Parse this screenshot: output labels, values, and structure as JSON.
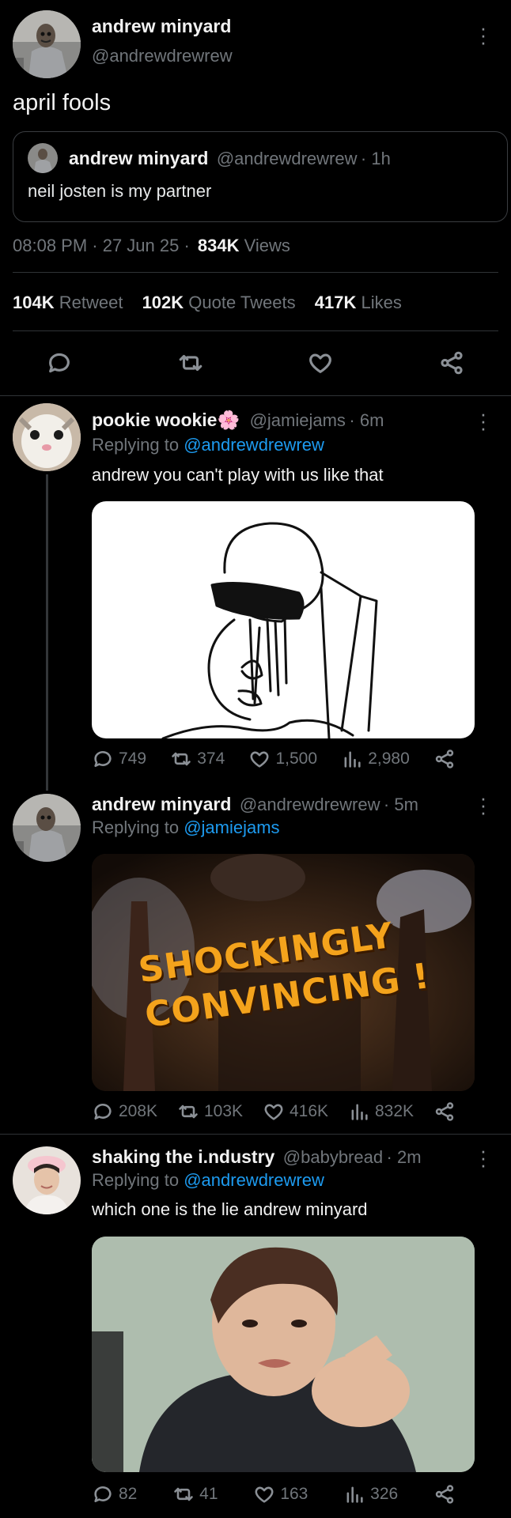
{
  "main_tweet": {
    "author_name": "andrew minyard",
    "author_handle": "@andrewdrewrew",
    "text": "april fools",
    "quoted": {
      "author_name": "andrew minyard",
      "author_handle": "@andrewdrewrew",
      "time": "· 1h",
      "text": "neil josten is my partner"
    },
    "timestamp": "08:08 PM · 27 Jun 25 ·",
    "views_count": "834K",
    "views_label": "Views",
    "retweets_count": "104K",
    "retweets_label": "Retweet",
    "quotes_count": "102K",
    "quotes_label": "Quote Tweets",
    "likes_count": "417K",
    "likes_label": "Likes"
  },
  "replies": [
    {
      "author_name": "pookie wookie🌸",
      "author_handle": "@jamiejams",
      "time": "· 6m",
      "replying_prefix": "Replying to",
      "replying_to": "@andrewdrewrew",
      "text": "andrew you can't play with us like that",
      "media_text": "",
      "stats": {
        "replies": "749",
        "retweets": "374",
        "likes": "1,500",
        "views": "2,980"
      }
    },
    {
      "author_name": "andrew minyard",
      "author_handle": "@andrewdrewrew",
      "time": "· 5m",
      "replying_prefix": "Replying to",
      "replying_to": "@jamiejams",
      "text": "",
      "media_text_line1": "SHOCKINGLY",
      "media_text_line2": "CONVINCING !",
      "stats": {
        "replies": "208K",
        "retweets": "103K",
        "likes": "416K",
        "views": "832K"
      }
    },
    {
      "author_name": "shaking the i.ndustry",
      "author_handle": "@babybread",
      "time": "· 2m",
      "replying_prefix": "Replying to",
      "replying_to": "@andrewdrewrew",
      "text": "which one is the lie andrew minyard",
      "stats": {
        "replies": "82",
        "retweets": "41",
        "likes": "163",
        "views": "326"
      }
    }
  ],
  "colors": {
    "background": "#000000",
    "link": "#1d9bf0",
    "muted": "#71767b",
    "divider": "#2f3336"
  }
}
